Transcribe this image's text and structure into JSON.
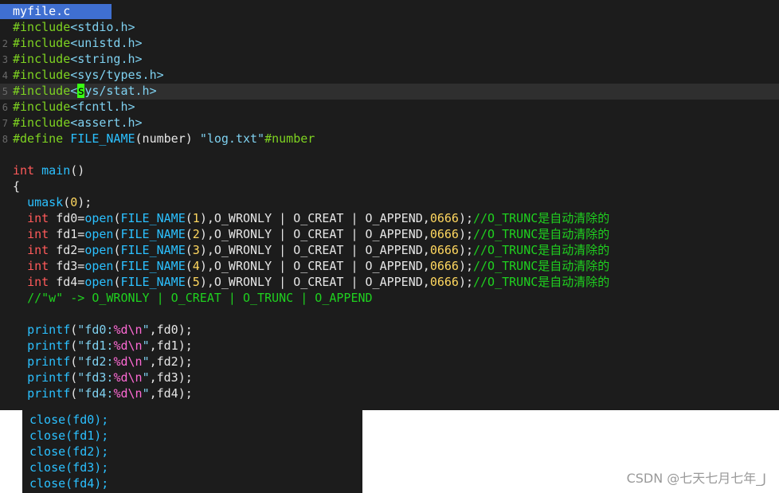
{
  "editor": {
    "tab_label": "myfile.c",
    "line_numbers": [
      "2",
      "3",
      "4",
      "5",
      "6",
      "7",
      "8"
    ],
    "lines": {
      "inc1_kw": "#include",
      "inc1_hdr": "<stdio.h>",
      "inc2_kw": "#include",
      "inc2_hdr": "<unistd.h>",
      "inc3_kw": "#include",
      "inc3_hdr": "<string.h>",
      "inc4_kw": "#include",
      "inc4_hdr": "<sys/types.h>",
      "inc5_kw": "#include",
      "inc5_hdr_a": "<",
      "inc5_cursor": "s",
      "inc5_hdr_b": "ys/stat.h>",
      "inc6_kw": "#include",
      "inc6_hdr": "<fcntl.h>",
      "inc7_kw": "#include",
      "inc7_hdr": "<assert.h>",
      "def_kw": "#define ",
      "def_name": "FILE_NAME",
      "def_rest1": "(number) ",
      "def_str": "\"log.txt\"",
      "def_rest2": "#number",
      "main_int": "int ",
      "main_name": "main",
      "main_paren": "()",
      "brace_open": "{",
      "umask_fn": "umask",
      "umask_p1": "(",
      "umask_num": "0",
      "umask_p2": ");",
      "vw_comment": "//\"w\" -> O_WRONLY | O_CREAT | O_TRUNC | O_APPEND"
    },
    "open_lines": [
      {
        "var": "fd0",
        "n": "1"
      },
      {
        "var": "fd1",
        "n": "2"
      },
      {
        "var": "fd2",
        "n": "3"
      },
      {
        "var": "fd3",
        "n": "4"
      },
      {
        "var": "fd4",
        "n": "5"
      }
    ],
    "open_parts": {
      "int_kw": "int ",
      "eq": "=",
      "open_fn": "open",
      "paren_open": "(",
      "macro": "FILE_NAME",
      "lp": "(",
      "rp": ")",
      "flags": ",O_WRONLY | O_CREAT | O_APPEND,",
      "mode": "0666",
      "end": ");",
      "comment": "//O_TRUNC是自动清除的"
    },
    "printf_lines": [
      {
        "str": "\"fd0:",
        "tail": ",fd0);"
      },
      {
        "str": "\"fd1:",
        "tail": ",fd1);"
      },
      {
        "str": "\"fd2:",
        "tail": ",fd2);"
      },
      {
        "str": "\"fd3:",
        "tail": ",fd3);"
      },
      {
        "str": "\"fd4:",
        "tail": ",fd4);"
      }
    ],
    "printf_parts": {
      "fn": "printf",
      "paren": "(",
      "fmt": "%d\\n",
      "quote": "\""
    },
    "close_lines": [
      "close(fd0);",
      "close(fd1);",
      "close(fd2);",
      "close(fd3);",
      "close(fd4);"
    ]
  },
  "watermark": "CSDN @七天七月七年_J"
}
